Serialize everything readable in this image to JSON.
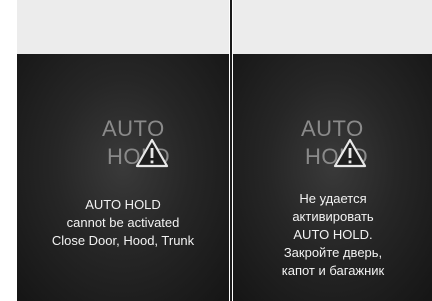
{
  "icon": {
    "line1": "AUTO",
    "line2": "HOLD",
    "warning_icon": "warning-triangle-icon"
  },
  "left_panel": {
    "message": [
      "AUTO HOLD",
      "cannot be activated",
      "Close Door, Hood, Trunk"
    ]
  },
  "right_panel": {
    "message": [
      "Не удается",
      "активировать",
      "AUTO HOLD.",
      "Закройте дверь,",
      "капот и багажник"
    ]
  },
  "colors": {
    "screen_bg": "#1c1c1c",
    "icon_text": "#8a8a8a",
    "message_text": "#f2f2f2",
    "frame_bg": "#ececec"
  }
}
